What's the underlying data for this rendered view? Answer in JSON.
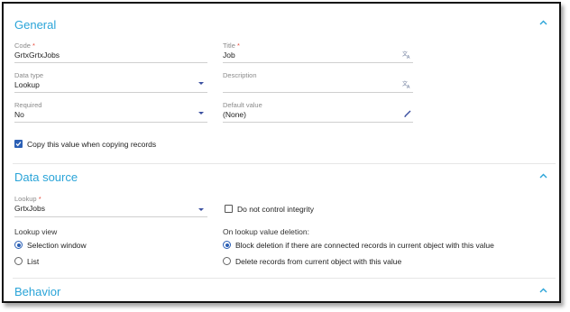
{
  "sections": {
    "general": {
      "title": "General",
      "collapse_icon": "chevron-up-icon",
      "fields": {
        "code": {
          "label": "Code",
          "required_mark": "*",
          "value": "GrtxGrtxJobs"
        },
        "title": {
          "label": "Title",
          "required_mark": "*",
          "value": "Job",
          "icon": "translate-icon"
        },
        "data_type": {
          "label": "Data type",
          "value": "Lookup",
          "icon": "dropdown-caret-icon"
        },
        "description": {
          "label": "Description",
          "value": "",
          "icon": "translate-icon"
        },
        "required": {
          "label": "Required",
          "value": "No",
          "icon": "dropdown-caret-icon"
        },
        "default_value": {
          "label": "Default value",
          "value": "(None)",
          "icon": "pencil-icon"
        }
      },
      "copy_value": {
        "label": "Copy this value when copying records",
        "checked": true
      }
    },
    "data_source": {
      "title": "Data source",
      "collapse_icon": "chevron-up-icon",
      "lookup": {
        "label": "Lookup",
        "required_mark": "*",
        "value": "GrtxJobs",
        "icon": "dropdown-caret-icon"
      },
      "do_not_control_integrity": {
        "label": "Do not control integrity",
        "checked": false
      },
      "lookup_view": {
        "label": "Lookup view",
        "options": [
          {
            "label": "Selection window",
            "selected": true
          },
          {
            "label": "List",
            "selected": false
          }
        ]
      },
      "on_deletion": {
        "label": "On lookup value deletion:",
        "options": [
          {
            "label": "Block deletion if there are connected records in current object with this value",
            "selected": true
          },
          {
            "label": "Delete records from current object with this value",
            "selected": false
          }
        ]
      }
    },
    "behavior": {
      "title": "Behavior",
      "collapse_icon": "chevron-up-icon"
    }
  },
  "colors": {
    "accent": "#2aa4d8",
    "control": "#2a5fb5",
    "required": "#e84b3c"
  }
}
